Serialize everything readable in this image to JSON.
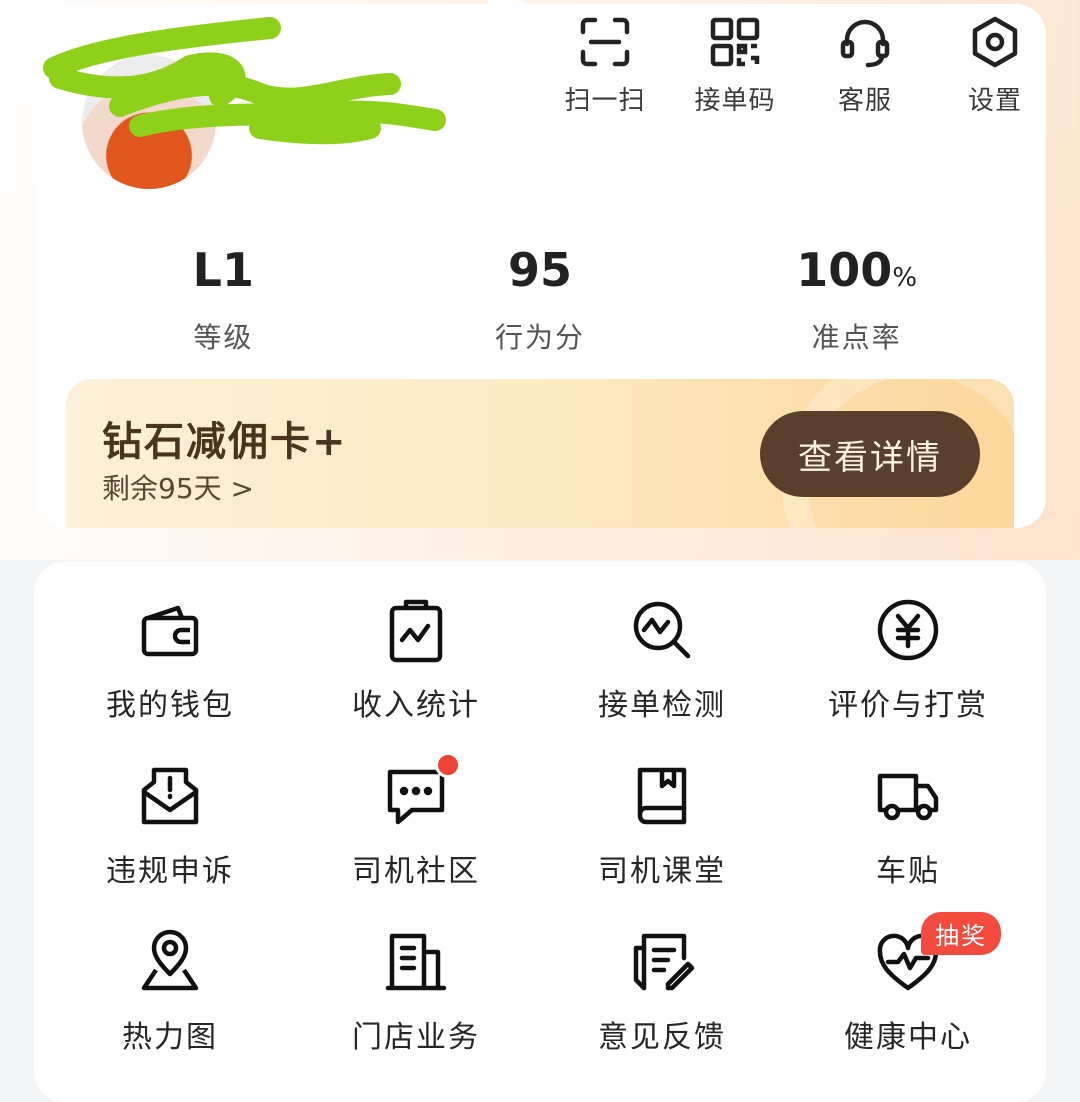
{
  "header_actions": [
    {
      "label": "扫一扫",
      "icon": "scan-icon"
    },
    {
      "label": "接单码",
      "icon": "qr-code-icon"
    },
    {
      "label": "客服",
      "icon": "headset-icon"
    },
    {
      "label": "设置",
      "icon": "settings-hexagon-icon"
    }
  ],
  "stats": [
    {
      "value": "L1",
      "unit": "",
      "label": "等级"
    },
    {
      "value": "95",
      "unit": "",
      "label": "行为分"
    },
    {
      "value": "100",
      "unit": "%",
      "label": "准点率"
    }
  ],
  "vip": {
    "title": "钻石减佣卡+",
    "subtitle": "剩余95天 >",
    "button": "查看详情"
  },
  "grid": [
    {
      "label": "我的钱包",
      "icon": "wallet-icon"
    },
    {
      "label": "收入统计",
      "icon": "clipboard-chart-icon"
    },
    {
      "label": "接单检测",
      "icon": "search-pulse-icon"
    },
    {
      "label": "评价与打赏",
      "icon": "yuan-coin-icon"
    },
    {
      "label": "违规申诉",
      "icon": "alert-envelope-icon"
    },
    {
      "label": "司机社区",
      "icon": "chat-bubble-icon"
    },
    {
      "label": "司机课堂",
      "icon": "book-icon"
    },
    {
      "label": "车贴",
      "icon": "truck-icon"
    },
    {
      "label": "热力图",
      "icon": "map-pin-icon"
    },
    {
      "label": "门店业务",
      "icon": "building-icon"
    },
    {
      "label": "意见反馈",
      "icon": "feedback-form-icon"
    },
    {
      "label": "健康中心",
      "icon": "heart-pulse-icon"
    }
  ],
  "badges": {
    "lottery": "抽奖"
  },
  "colors": {
    "accent_brown": "#5a3f2c",
    "vip_gold": "#fde9c3",
    "badge_red": "#f24a3d",
    "redaction_green": "#8fd11a"
  }
}
